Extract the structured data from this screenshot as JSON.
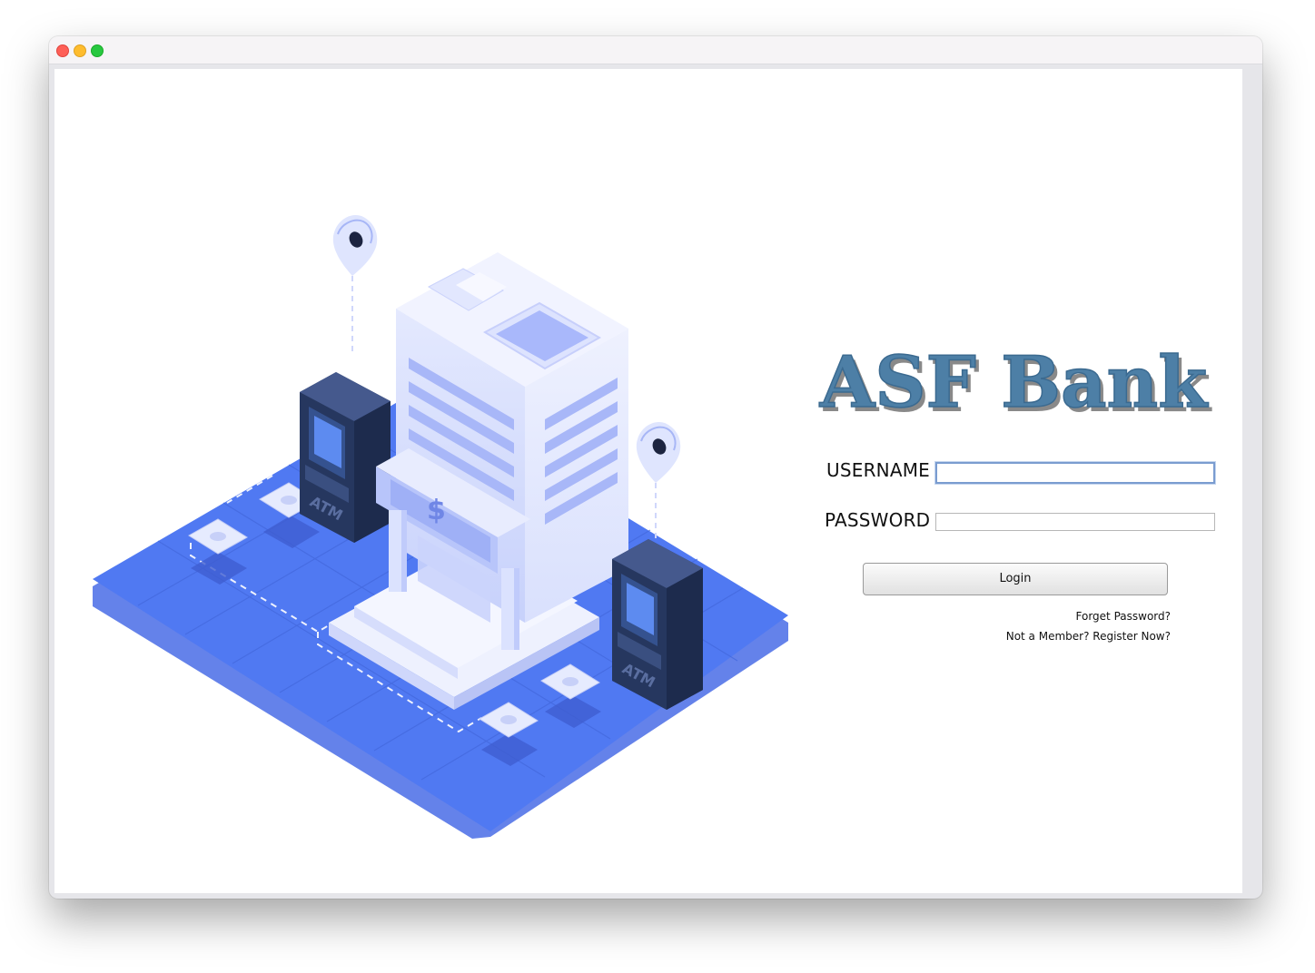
{
  "window": {
    "controls": [
      "close",
      "minimize",
      "zoom"
    ]
  },
  "brand": {
    "name": "ASF Bank",
    "color": "#4d7fa6"
  },
  "illustration": {
    "icon": "bank-building-atm-illustration",
    "atm_label": "ATM",
    "currency_symbol": "$"
  },
  "form": {
    "username_label": "USERNAME",
    "username_value": "",
    "password_label": "PASSWORD",
    "password_value": "",
    "login_label": "Login",
    "forget_password_label": "Forget Password?",
    "register_label": "Not a Member? Register Now?"
  },
  "colors": {
    "platform": "#4f79f0",
    "building": "#dfe5fd",
    "atm": "#2d3d66"
  }
}
